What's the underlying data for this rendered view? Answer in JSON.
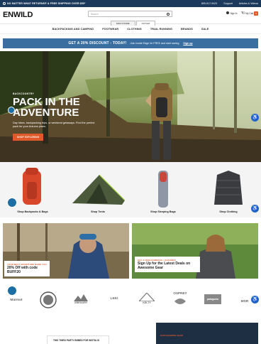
{
  "topbar": {
    "promo": "NO MATTER WHAT RETURNS® & FREE SHIPPING OVER $50*",
    "phone": "800-617-9423",
    "support": "Support",
    "articles": "Articles & Videos"
  },
  "header": {
    "logo": "ENWILD",
    "search_placeholder": "Search",
    "store_tabs": [
      "MAIN STORE",
      "OUTLET"
    ],
    "signin": "Sign In",
    "cart": "My Cart",
    "cart_count": "0"
  },
  "nav": [
    "BACKPACKING AND CAMPING",
    "FOOTWEAR",
    "CLOTHING",
    "TRAIL RUNNING",
    "BRANDS",
    "SALE"
  ],
  "promo_banner": {
    "headline": "GET A 20% DISCOUNT - TODAY!",
    "text": "Join Inside Edge for FREE and start saving.",
    "cta": "Sign up"
  },
  "hero": {
    "eyebrow": "BACKCOUNTRY",
    "title_line1": "PACK IN THE",
    "title_line2": "ADVENTURE",
    "subtitle": "Day hikes, backpacking trips, or weekend getaways. Find the perfect pack for your Autumn plans.",
    "cta": "SHOP EXPLORING"
  },
  "categories": [
    {
      "label": "Shop Backpacks & Bags",
      "icon": "backpack-icon"
    },
    {
      "label": "Shop Tents",
      "icon": "tent-icon"
    },
    {
      "label": "Shop Sleeping Bags",
      "icon": "sleeping-bag-icon"
    },
    {
      "label": "Shop Clothing",
      "icon": "jacket-icon"
    }
  ],
  "features": [
    {
      "eyebrow": "YOUR NEXT ADVENTURE MADE YOU",
      "headline": "20% Off with code BUFF20"
    },
    {
      "eyebrow": "GET A FREE BANDANA • GIVEAWAY",
      "headline": "Sign Up for the Latest Deals on Awesome Gear"
    }
  ],
  "brands": [
    "Marmot",
    "",
    "GREGORY",
    "LEKI",
    "KELTY",
    "OSPREY",
    "patagonia",
    "MSR"
  ],
  "bottom": {
    "box_text": "THIS THIRD PARTY EMBED FOR WISTIA IS",
    "dark_text": "OUR FAVORITE GEAR"
  },
  "colors": {
    "accent": "#e0592a",
    "navy": "#1b3a5b",
    "banner": "#3a6ea0"
  }
}
